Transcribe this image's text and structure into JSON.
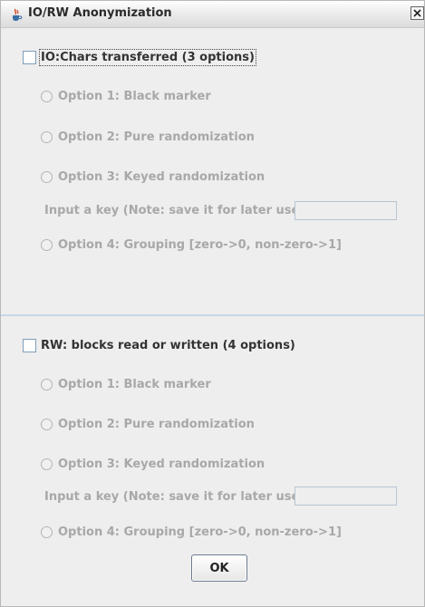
{
  "window": {
    "title": "IO/RW Anonymization"
  },
  "io_section": {
    "header": "IO:Chars transferred (3 options)",
    "option1": "Option 1: Black marker",
    "option2": "Option 2: Pure randomization",
    "option3": "Option 3: Keyed randomization",
    "key_label": "Input a key (Note: save it for later use):",
    "key_value": "",
    "option4": "Option 4: Grouping [zero->0, non-zero->1]"
  },
  "rw_section": {
    "header": "RW: blocks read or written (4 options)",
    "option1": "Option 1: Black marker",
    "option2": "Option 2: Pure randomization",
    "option3": "Option 3: Keyed randomization",
    "key_label": "Input a key (Note: save it for later use):",
    "key_value": "",
    "option4": "Option 4: Grouping [zero->0, non-zero->1]"
  },
  "buttons": {
    "ok": "OK"
  },
  "icons": {
    "app": "java-cup-icon",
    "close": "close-icon"
  },
  "colors": {
    "disabled_text": "#a8a8a8",
    "checkbox_border": "#7f9db9",
    "divider": "#c7d7e5"
  }
}
